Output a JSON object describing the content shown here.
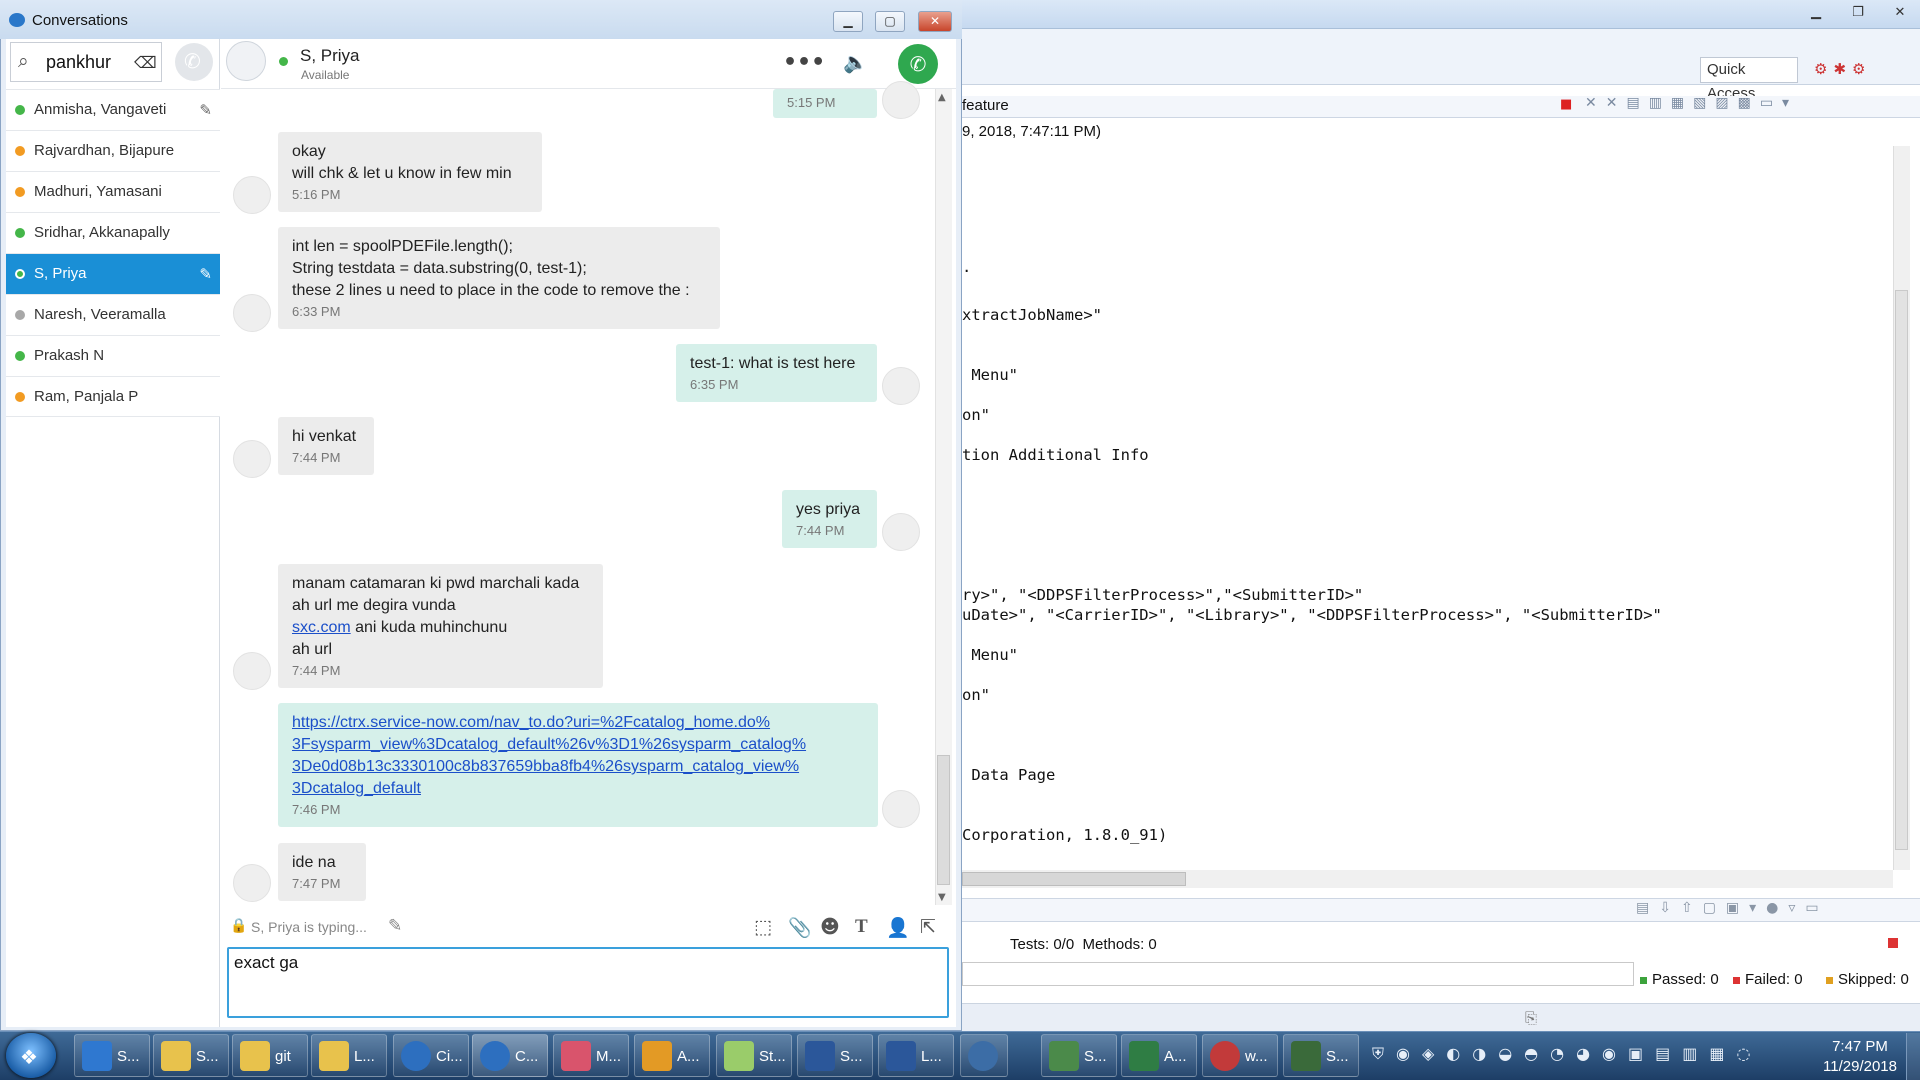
{
  "eclipse": {
    "quick_access": "Quick Access",
    "editor_tab": "feature",
    "header_line": "9, 2018, 7:47:11 PM)",
    "code_lines": [
      "xtractJobName>\"",
      " Menu\"",
      "on\"",
      "tion Additional Info",
      "ry>\", \"<DDPSFilterProcess>\",\"<SubmitterID>\"",
      "uDate>\", \"<CarrierID>\", \"<Library>\", \"<DDPSFilterProcess>\", \"<SubmitterID>\"",
      " Menu\"",
      "on\"",
      " Data Page",
      "Corporation, 1.8.0_91)"
    ],
    "tests": "Tests: 0/0  Methods: 0",
    "passed": "Passed: 0",
    "failed": "Failed: 0",
    "skipped": "Skipped: 0"
  },
  "conversations": {
    "title": "Conversations",
    "search_value": "pankhur",
    "contacts": [
      {
        "name": "Anmisha, Vangaveti",
        "status": "available",
        "color": "#44b649"
      },
      {
        "name": "Rajvardhan, Bijapure",
        "status": "away",
        "color": "#f29b22"
      },
      {
        "name": "Madhuri, Yamasani",
        "status": "away",
        "color": "#f29b22"
      },
      {
        "name": "Sridhar, Akkanapally",
        "status": "available",
        "color": "#44b649"
      },
      {
        "name": "S, Priya",
        "status": "available",
        "color": "#44b649"
      },
      {
        "name": "Naresh, Veeramalla",
        "status": "offline",
        "color": "#a8a8a8"
      },
      {
        "name": "Prakash N",
        "status": "available",
        "color": "#44b649"
      },
      {
        "name": "Ram, Panjala P",
        "status": "away",
        "color": "#f29b22"
      }
    ],
    "chat": {
      "name": "S, Priya",
      "status": "Available",
      "typing": "S, Priya is typing...",
      "compose_value": "exact ga",
      "messages": [
        {
          "dir": "out",
          "lines": [],
          "time": "5:15 PM"
        },
        {
          "dir": "in",
          "lines": [
            "okay",
            "will chk & let u know in few min"
          ],
          "time": "5:16 PM"
        },
        {
          "dir": "in",
          "lines": [
            "int len = spoolPDEFile.length();",
            "String testdata = data.substring(0, test-1);",
            "these 2 lines u need to place in the code to remove the :"
          ],
          "time": "6:33 PM"
        },
        {
          "dir": "out",
          "lines": [
            "test-1: what is test here"
          ],
          "time": "6:35 PM"
        },
        {
          "dir": "in",
          "lines": [
            "hi venkat"
          ],
          "time": "7:44 PM"
        },
        {
          "dir": "out",
          "lines": [
            "yes priya"
          ],
          "time": "7:44 PM"
        },
        {
          "dir": "in",
          "lines": [
            "manam catamaran ki pwd marchali kada",
            "ah url me degira vunda"
          ],
          "link": "sxc.com",
          "link_rest": " ani kuda muhinchunu",
          "after": "ah url",
          "time": "7:44 PM"
        },
        {
          "dir": "out",
          "link_lines": [
            "https://ctrx.service-now.com/nav_to.do?uri=%2Fcatalog_home.do%",
            "3Fsysparm_view%3Dcatalog_default%26v%3D1%26sysparm_catalog%",
            "3De0d08b13c3330100c8b837659bba8fb4%26sysparm_catalog_view%",
            "3Dcatalog_default"
          ],
          "time": "7:46 PM"
        },
        {
          "dir": "in",
          "lines": [
            "ide na"
          ],
          "time": "7:47 PM"
        }
      ]
    }
  },
  "taskbar": {
    "items": [
      {
        "label": "S...",
        "color": "#2f78d0"
      },
      {
        "label": "S...",
        "color": "#e8c24c"
      },
      {
        "label": "git",
        "color": "#e8c24c"
      },
      {
        "label": "L...",
        "color": "#e8c24c"
      },
      {
        "label": "Ci...",
        "color": "#2d6fbf"
      },
      {
        "label": "C...",
        "color": "#2d6fbf"
      },
      {
        "label": "M...",
        "color": "#d9546c"
      },
      {
        "label": "A...",
        "color": "#e39a25"
      },
      {
        "label": "St...",
        "color": "#9acc6a"
      },
      {
        "label": "S...",
        "color": "#2b579a"
      },
      {
        "label": "L...",
        "color": "#2b579a"
      },
      {
        "label": "",
        "color": "#3c6da6"
      },
      {
        "label": "S...",
        "color": "#4b8a4a"
      },
      {
        "label": "A...",
        "color": "#2f7d44"
      },
      {
        "label": "w...",
        "color": "#c23a3a"
      },
      {
        "label": "S...",
        "color": "#3a6a3a"
      }
    ],
    "time": "7:47 PM",
    "date": "11/29/2018"
  }
}
